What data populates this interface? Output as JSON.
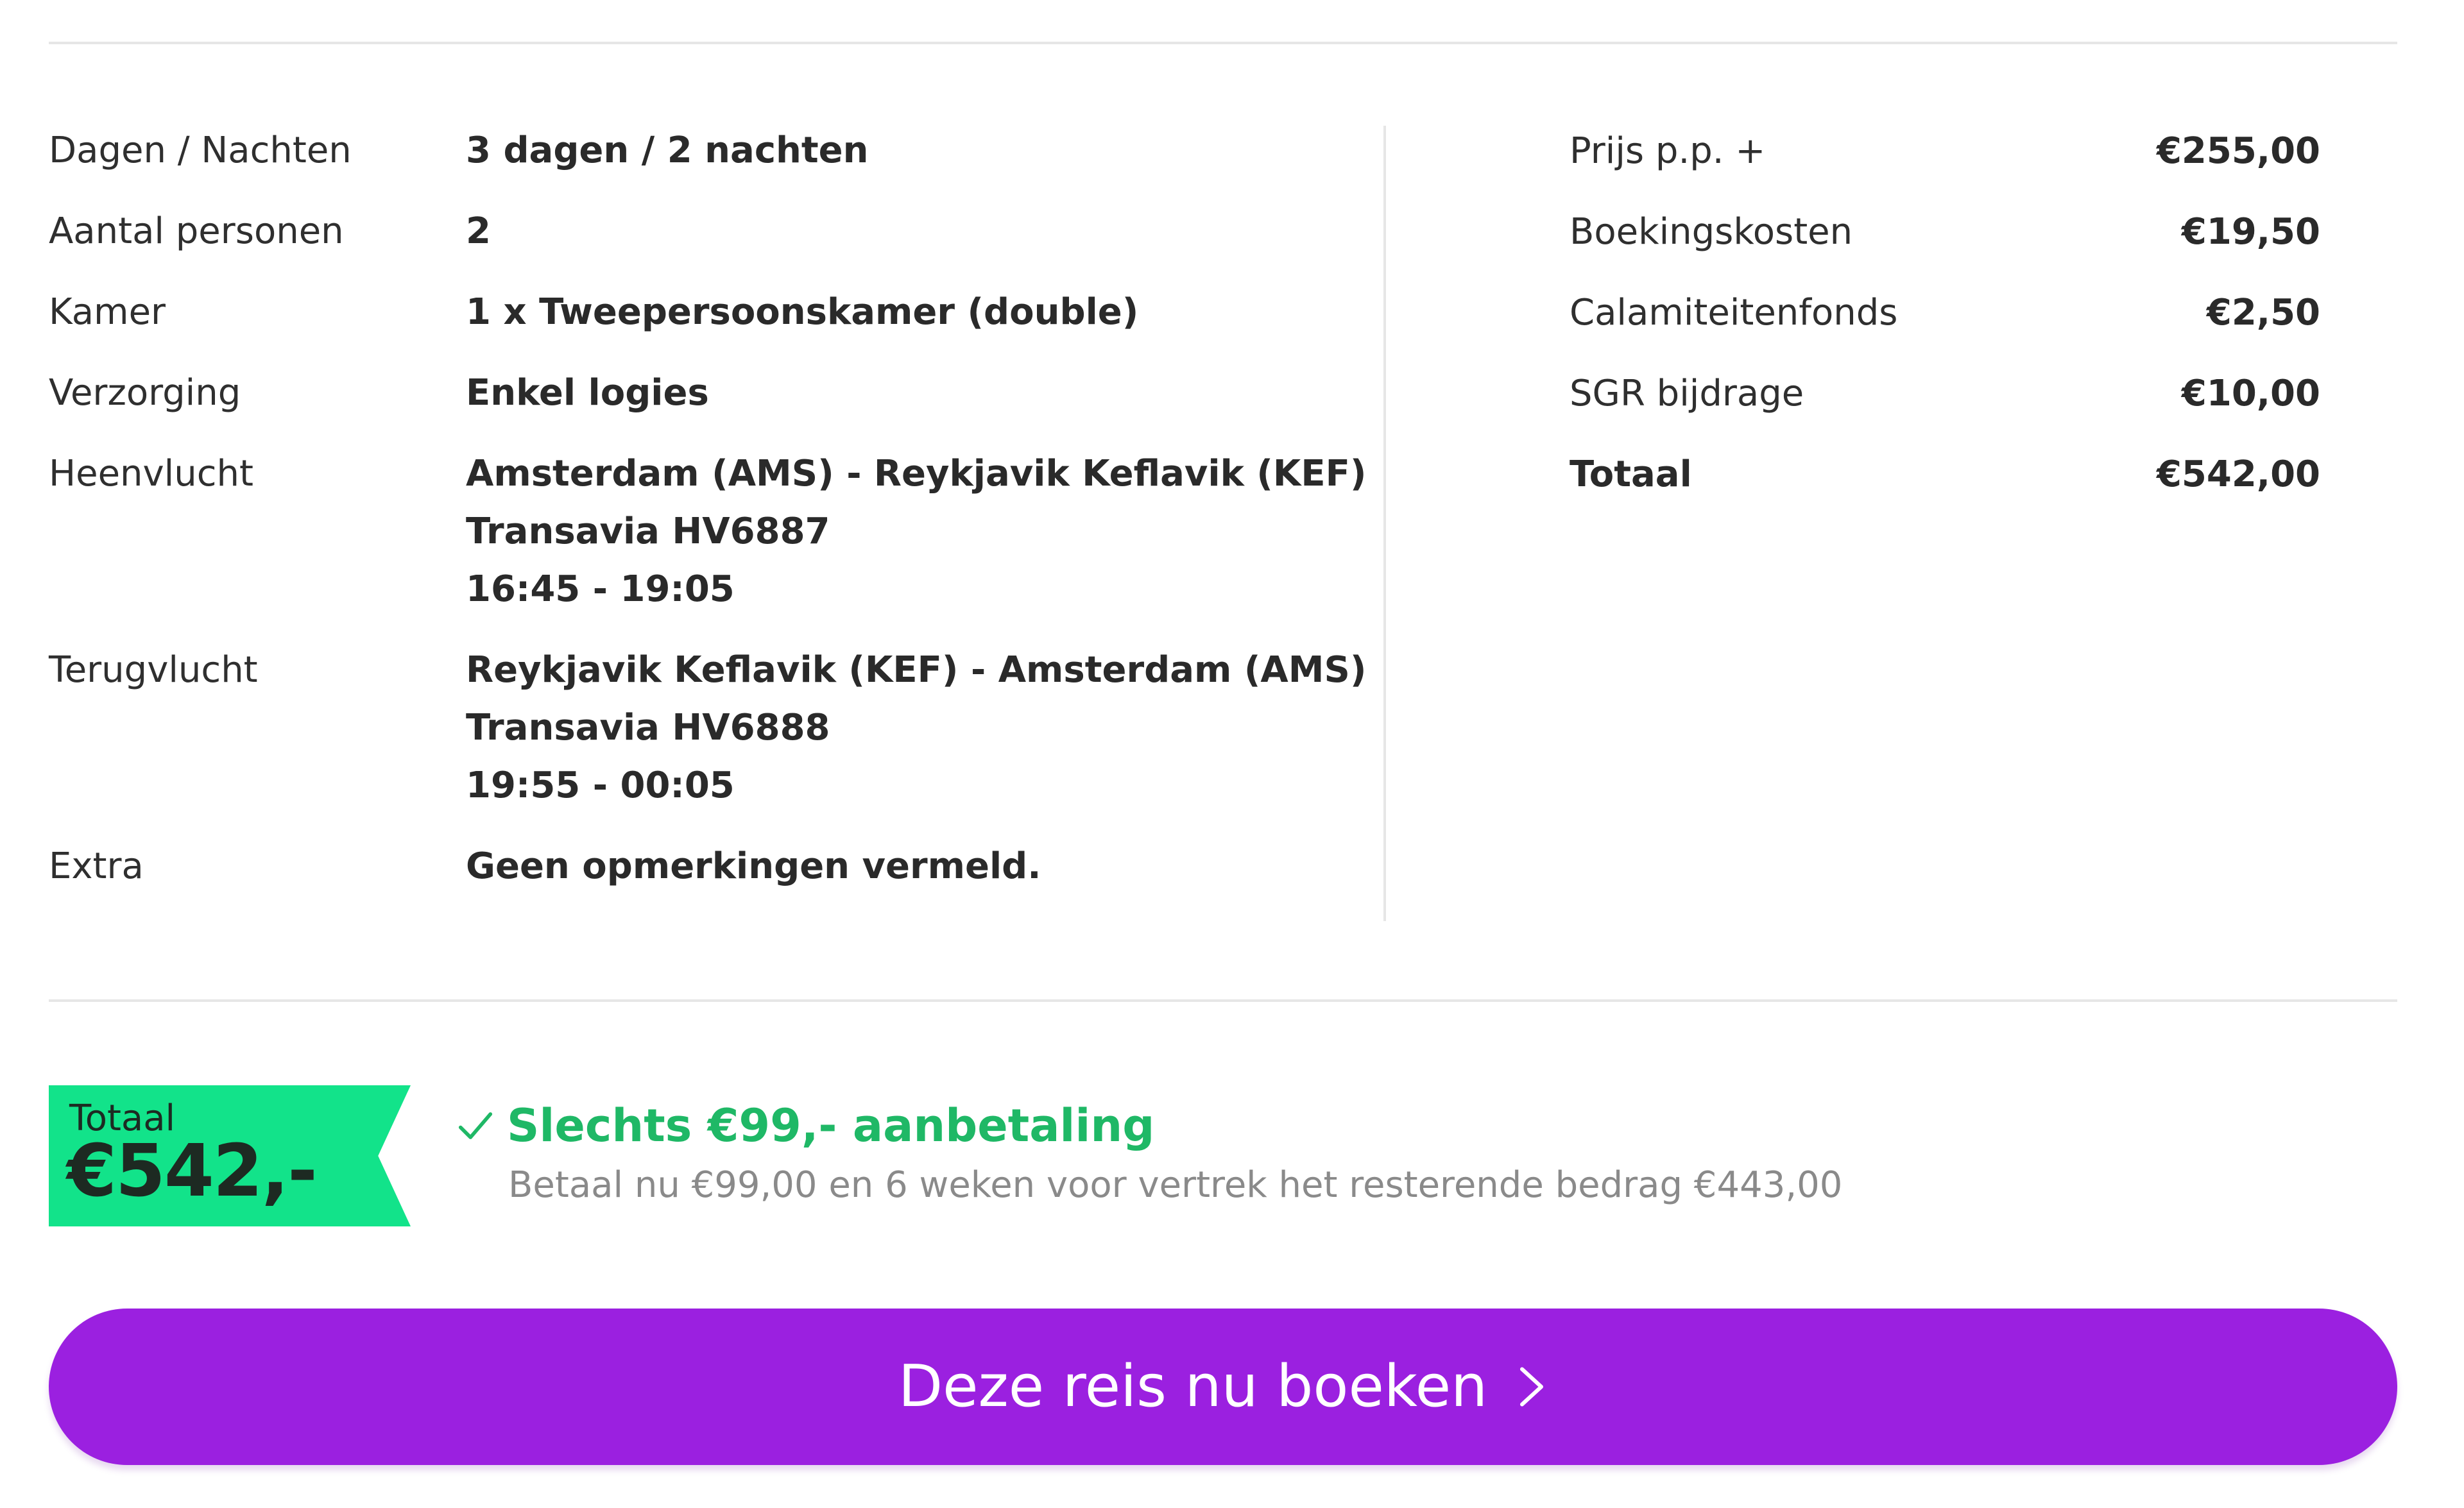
{
  "details": [
    {
      "label": "Dagen / Nachten",
      "lines": [
        "3 dagen / 2 nachten"
      ]
    },
    {
      "label": "Aantal personen",
      "lines": [
        "2"
      ]
    },
    {
      "label": "Kamer",
      "lines": [
        "1 x Tweepersoonskamer (double)"
      ]
    },
    {
      "label": "Verzorging",
      "lines": [
        "Enkel logies"
      ]
    },
    {
      "label": "Heenvlucht",
      "lines": [
        "Amsterdam (AMS) - Reykjavik Keflavik (KEF)",
        "Transavia HV6887",
        "16:45 - 19:05"
      ]
    },
    {
      "label": "Terugvlucht",
      "lines": [
        "Reykjavik Keflavik (KEF) - Amsterdam (AMS)",
        "Transavia HV6888",
        "19:55 - 00:05"
      ]
    },
    {
      "label": "Extra",
      "lines": [
        "Geen opmerkingen vermeld."
      ]
    }
  ],
  "prices": [
    {
      "label": "Prijs p.p. +",
      "value": "€255,00"
    },
    {
      "label": "Boekingskosten",
      "value": "€19,50"
    },
    {
      "label": "Calamiteitenfonds",
      "value": "€2,50"
    },
    {
      "label": "SGR bijdrage",
      "value": "€10,00"
    },
    {
      "label": "Totaal",
      "value": "€542,00"
    }
  ],
  "total_tag": {
    "label": "Totaal",
    "amount": "€542,-",
    "color": "#12e38a"
  },
  "deposit": {
    "icon": "checkmark-icon",
    "headline": "Slechts €99,- aanbetaling",
    "subtext": "Betaal nu €99,00 en 6 weken voor vertrek het resterende bedrag €443,00",
    "color": "#1fb866"
  },
  "book_button": {
    "label": "Deze reis nu boeken",
    "icon": "chevron-right-icon",
    "color": "#9b20e0"
  }
}
